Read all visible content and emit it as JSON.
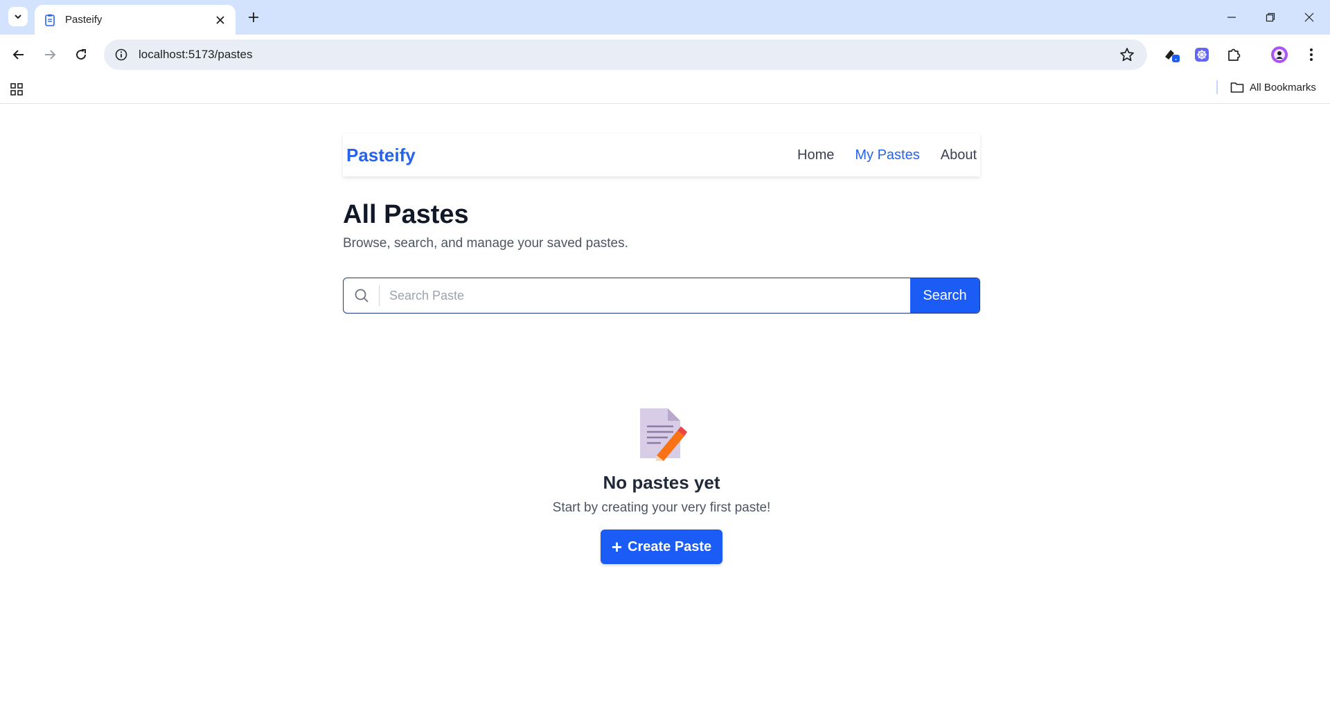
{
  "browser": {
    "tab_title": "Pasteify",
    "url": "localhost:5173/pastes",
    "all_bookmarks_label": "All Bookmarks",
    "icons": [
      "tab-search-icon",
      "tab-favicon-icon",
      "close-icon",
      "plus-icon",
      "minimize-icon",
      "restore-icon",
      "window-close-icon",
      "back-arrow-icon",
      "forward-arrow-icon",
      "reload-icon",
      "info-icon",
      "star-icon",
      "extension-icon",
      "puzzle-icon",
      "profile-avatar",
      "more-vert-icon",
      "apps-grid-icon",
      "folder-icon"
    ]
  },
  "navbar": {
    "brand": "Pasteify",
    "links": [
      {
        "label": "Home",
        "active": false
      },
      {
        "label": "My Pastes",
        "active": true
      },
      {
        "label": "About",
        "active": false
      }
    ]
  },
  "main": {
    "title": "All Pastes",
    "subtitle": "Browse, search, and manage your saved pastes.",
    "search": {
      "placeholder": "Search Paste",
      "value": "",
      "button_label": "Search"
    },
    "empty_state": {
      "icon": "memo-emoji-icon",
      "title": "No pastes yet",
      "text": "Start by creating your very first paste!",
      "button_label": "Create Paste",
      "button_icon": "+"
    }
  },
  "colors": {
    "brand": "#2563eb",
    "button": "#1a5cf5",
    "tabbar": "#d3e3fd",
    "omnibox": "#e9eef6"
  }
}
